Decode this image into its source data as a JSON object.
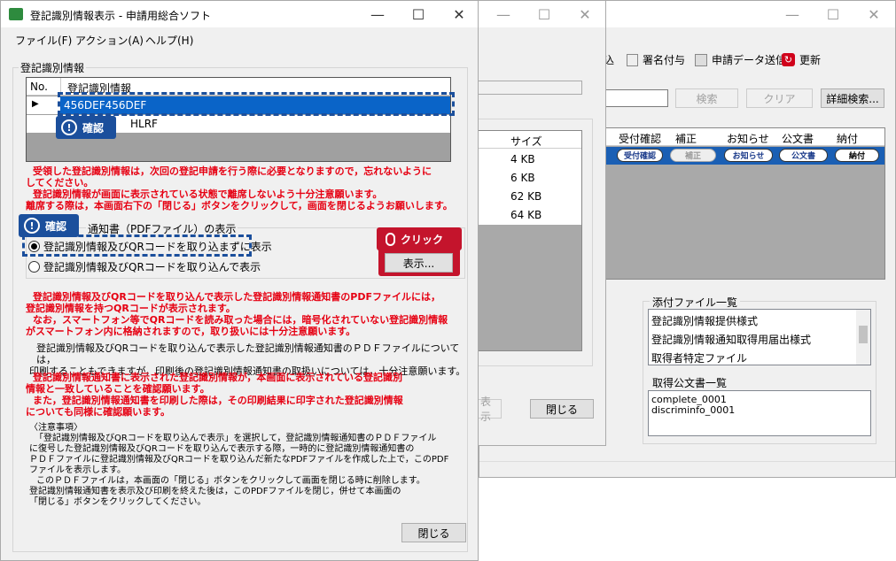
{
  "back_window": {
    "toolbar": {
      "partial_label": "込",
      "sign_label": "署名付与",
      "send_label": "申請データ送信",
      "refresh_label": "更新"
    },
    "search_button": "検索",
    "clear_button": "クリア",
    "detail_search_button": "詳細検索...",
    "table_headers": [
      "受付確認",
      "補正",
      "お知らせ",
      "公文書",
      "納付"
    ],
    "row_pills": [
      "受付確認",
      "補正",
      "お知らせ",
      "公文書",
      "納付"
    ],
    "attachments_title": "添付ファイル一覧",
    "attachments": [
      "登記識別情報提供様式",
      "登記識別情報通知取得用届出様式",
      "取得者特定ファイル"
    ],
    "documents_title": "取得公文書一覧",
    "documents": [
      "complete_0001",
      "discriminfo_0001"
    ]
  },
  "middle_window": {
    "size_header": "サイズ",
    "sizes": [
      "4 KB",
      "6 KB",
      "62 KB",
      "64 KB"
    ],
    "display_button": "表示",
    "close_button": "閉じる"
  },
  "front_window": {
    "title": "登記識別情報表示 - 申請用総合ソフト",
    "menu": [
      "ファイル(F)",
      "アクション(A)",
      "ヘルプ(H)"
    ],
    "group_label": "登記識別情報",
    "grid_headers": [
      "No.",
      "登記識別情報"
    ],
    "grid_row_value": "456DEF456DEF",
    "grid_row2_partial": "HLRF",
    "warning_lines": [
      "受領した登記識別情報は，次回の登記申請を行う際に必要となりますので，忘れないように",
      "してください。",
      "登記識別情報が画面に表示されている状態で離席しないよう十分注意願います。",
      "離席する際は，本画面右下の「閉じる」ボタンをクリックして，画面を閉じるようお願いします。"
    ],
    "pdf_group_label": "通知書（PDFファイル）の表示",
    "radio1": "登記識別情報及びQRコードを取り込まずに表示",
    "radio2": "登記識別情報及びQRコードを取り込んで表示",
    "display_button": "表示...",
    "para1_red": [
      "登記識別情報及びQRコードを取り込んで表示した登記識別情報通知書のPDFファイルには，",
      "登記識別情報を持つQRコードが表示されます。",
      "なお，スマートフォン等でQRコードを読み取った場合には，暗号化されていない登記識別情報",
      "がスマートフォン内に格納されますので，取り扱いには十分注意願います。"
    ],
    "para2": [
      "登記識別情報及びQRコードを取り込んで表示した登記識別情報通知書のＰＤＦファイルについては，",
      "印刷することもできますが，印刷後の登記識別情報通知書の取扱いについては，十分注意願います。"
    ],
    "para3_red": [
      "登記識別情報通知書に表示された登記識別情報が，本画面に表示されている登記識別",
      "情報と一致していることを確認願います。",
      "また，登記識別情報通知書を印刷した際は，その印刷結果に印字された登記識別情報",
      "についても同様に確認願います。"
    ],
    "notes": [
      "〈注意事項〉",
      "「登記識別情報及びQRコードを取り込んで表示」を選択して，登記識別情報通知書のＰＤＦファイル",
      "に復号した登記識別情報及びQRコードを取り込んで表示する際，一時的に登記識別情報通知書の",
      "ＰＤＦファイルに登記識別情報及びQRコードを取り込んだ新たなPDFファイルを作成した上で，このPDF",
      "ファイルを表示します。",
      "このＰＤＦファイルは，本画面の「閉じる」ボタンをクリックして画面を閉じる時に削除します。",
      "登記識別情報通知書を表示及び印刷を終えた後は，このPDFファイルを閉じ，併せて本画面の",
      "「閉じる」ボタンをクリックしてください。"
    ],
    "close_button": "閉じる",
    "callout_confirm_1": "確認",
    "callout_confirm_2": "確認",
    "callout_click": "クリック"
  }
}
